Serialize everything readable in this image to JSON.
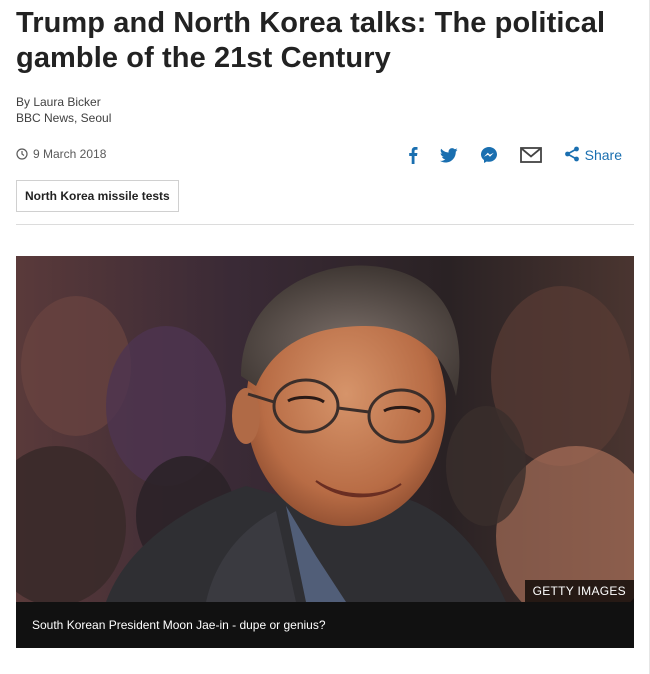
{
  "article": {
    "headline": "Trump and North Korea talks: The political gamble of the 21st Century",
    "author": "By Laura Bicker",
    "outlet": "BBC News, Seoul",
    "date": "9 March 2018",
    "tag": "North Korea missile tests"
  },
  "share": {
    "icons": [
      "facebook-icon",
      "twitter-icon",
      "messenger-icon",
      "email-icon",
      "share-icon"
    ],
    "label": "Share",
    "accent_color": "#1a6fb0"
  },
  "figure": {
    "credit": "GETTY IMAGES",
    "caption": "South Korean President Moon Jae-in - dupe or genius?"
  }
}
